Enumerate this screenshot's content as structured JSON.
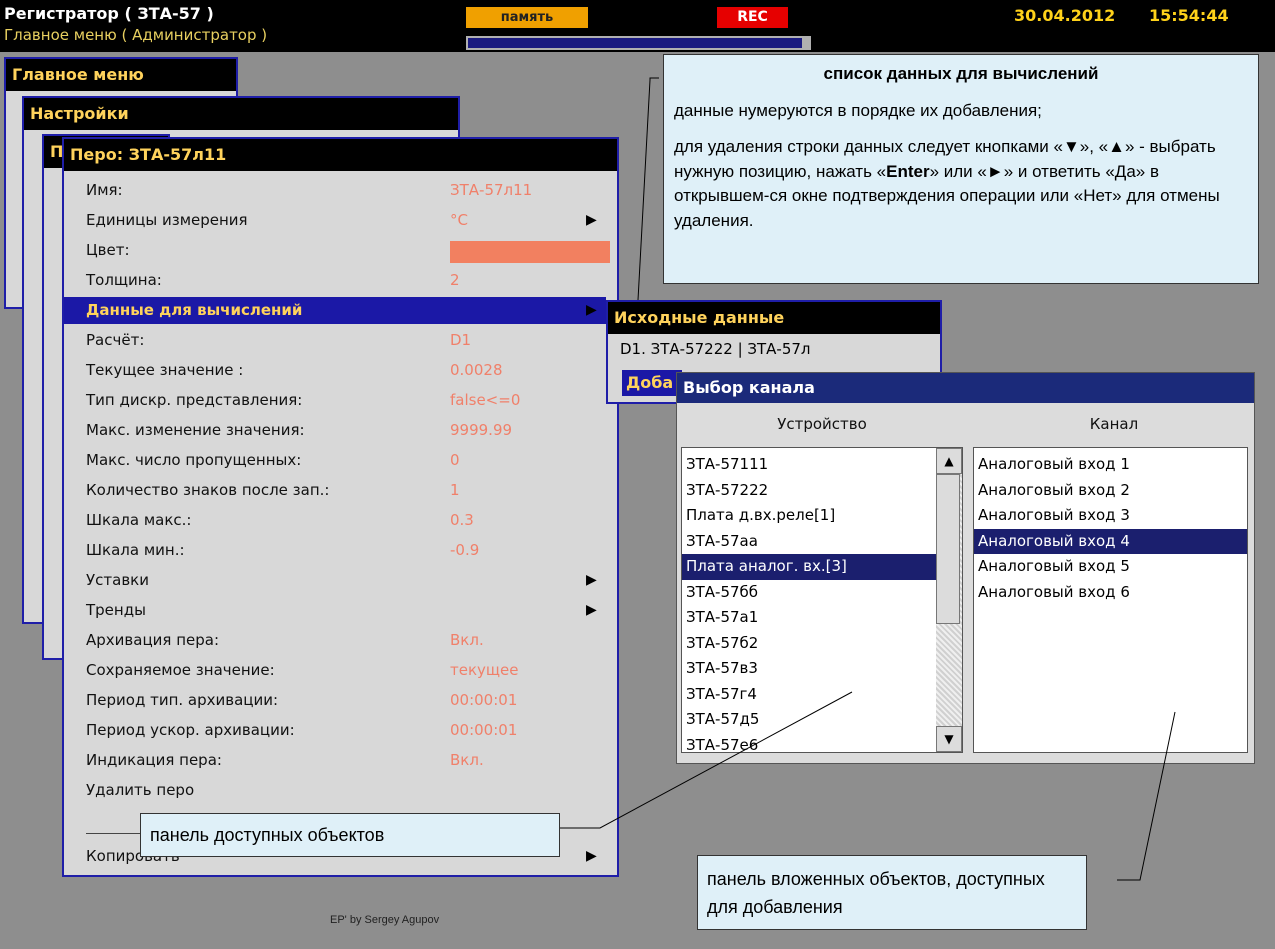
{
  "topbar": {
    "title": "Регистратор ( ЗТА-57 )",
    "subtitle": "Главное меню ( Администратор )",
    "memory_label": "память",
    "rec_label": "REC",
    "date": "30.04.2012",
    "time": "15:54:44",
    "memory_fill_fraction": 0.98
  },
  "menus": {
    "main_menu_title": "Главное меню",
    "settings_title": "Настройки",
    "nested_title": "П"
  },
  "pen": {
    "title": "Перо: ЗТА-57л11",
    "rows": [
      {
        "label": "Имя:",
        "value": "ЗТА-57л11"
      },
      {
        "label": "Единицы измерения",
        "value": "°C",
        "arrow": "▶"
      },
      {
        "label": "Цвет:",
        "swatch": true
      },
      {
        "label": "Толщина:",
        "value": "2"
      },
      {
        "label": "Данные для вычислений",
        "value": "",
        "arrow": "▶",
        "selected": true
      },
      {
        "label": "Расчёт:",
        "value": "D1"
      },
      {
        "label": "Текущее значение :",
        "value": "0.0028"
      },
      {
        "label": "Тип дискр. представления:",
        "value": "false<=0"
      },
      {
        "label": "Макс. изменение значения:",
        "value": "9999.99"
      },
      {
        "label": "Макс. число пропущенных:",
        "value": "0"
      },
      {
        "label": "Количество знаков после зап.:",
        "value": "1"
      },
      {
        "label": "Шкала макс.:",
        "value": "0.3"
      },
      {
        "label": "Шкала мин.:",
        "value": "-0.9"
      },
      {
        "label": "Уставки",
        "value": "",
        "arrow": "▶"
      },
      {
        "label": "Тренды",
        "value": "",
        "arrow": "▶"
      },
      {
        "label": "Архивация пера:",
        "value": "Вкл."
      },
      {
        "label": "Сохраняемое значение:",
        "value": "текущее"
      },
      {
        "label": "Период тип. архивации:",
        "value": "00:00:01"
      },
      {
        "label": "Период ускор. архивации:",
        "value": "00:00:01"
      },
      {
        "label": "Индикация пера:",
        "value": "Вкл."
      },
      {
        "label": "Удалить перо",
        "value": ""
      }
    ],
    "copy_label": "Копировать",
    "copy_arrow": "▶",
    "swatch_color": "#f28060"
  },
  "source": {
    "title": "Исходные данные",
    "item": "D1. ЗТА-57222 | ЗТА-57л",
    "add_label_partial": "Доба"
  },
  "channel_dialog": {
    "title": "Выбор канала",
    "device_header": "Устройство",
    "channel_header": "Канал",
    "devices": [
      "ЗТА-57111",
      "ЗТА-57222",
      "Плата д.вх.реле[1]",
      "ЗТА-57аа",
      "Плата аналог. вх.[3]",
      "ЗТА-57бб",
      "ЗТА-57а1",
      "ЗТА-57б2",
      "ЗТА-57в3",
      "ЗТА-57г4",
      "ЗТА-57д5",
      "ЗТА-57е6"
    ],
    "selected_device_index": 4,
    "channels": [
      "Аналоговый вход 1",
      "Аналоговый вход 2",
      "Аналоговый вход 3",
      "Аналоговый вход 4",
      "Аналоговый вход 5",
      "Аналоговый вход 6"
    ],
    "selected_channel_index": 3,
    "scroll_up": "▲",
    "scroll_down": "▼"
  },
  "callouts": {
    "top_title": "список данных для вычислений",
    "top_line1": "данные нумеруются в порядке их добавления;",
    "top_p2_a": "для удаления строки данных следует кнопками «",
    "top_p2_down": "▼",
    "top_p2_b": "», «",
    "top_p2_up": "▲",
    "top_p2_c": "» - выбрать нужную позицию, нажать «",
    "top_p2_enter": "Enter",
    "top_p2_d": "» или «",
    "top_p2_right": "►",
    "top_p2_e": "» и ответить «Да» в открывшем-ся окне подтверждения операции или «Нет» для отмены удаления.",
    "bottom_left": "панель доступных объектов",
    "bottom_right": "панель вложенных объектов, доступных для добавления"
  },
  "footer_text": "EP' by Sergey Agupov"
}
